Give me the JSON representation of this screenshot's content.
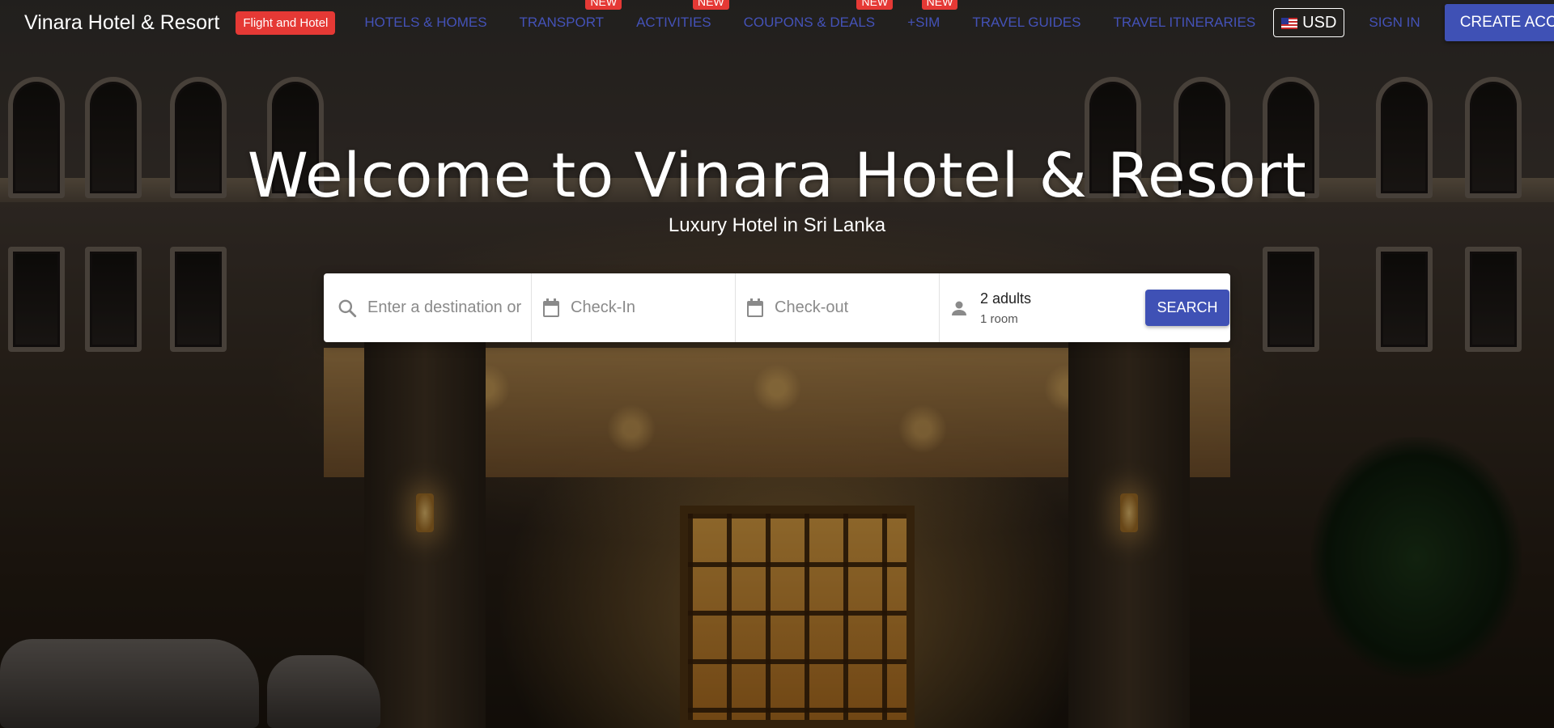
{
  "brand": {
    "name": "Vinara Hotel & Resort",
    "flight_badge": "Flight and Hotel"
  },
  "nav": {
    "links": [
      {
        "label": "HOTELS & HOMES",
        "badge": ""
      },
      {
        "label": "TRANSPORT",
        "badge": "NEW"
      },
      {
        "label": "ACTIVITIES",
        "badge": "NEW"
      },
      {
        "label": "COUPONS & DEALS",
        "badge": "NEW"
      },
      {
        "label": "+SIM",
        "badge": "NEW"
      },
      {
        "label": "TRAVEL GUIDES",
        "badge": ""
      },
      {
        "label": "TRAVEL ITINERARIES",
        "badge": ""
      }
    ],
    "currency": "USD",
    "sign_in": "SIGN IN",
    "create_account": "CREATE ACCOUNT"
  },
  "hero": {
    "title": "Welcome to Vinara Hotel & Resort",
    "subtitle": "Luxury Hotel in Sri Lanka"
  },
  "search": {
    "destination_placeholder": "Enter a destination or property",
    "checkin_placeholder": "Check-In",
    "checkout_placeholder": "Check-out",
    "adults": "2 adults",
    "rooms": "1 room",
    "button": "SEARCH"
  },
  "icons": {
    "search": "search-icon",
    "calendar": "calendar-icon",
    "person": "person-icon",
    "flag": "us-flag-icon"
  },
  "colors": {
    "primary": "#3f51b5",
    "nav_link": "#4452b8",
    "badge_red": "#e53935"
  }
}
